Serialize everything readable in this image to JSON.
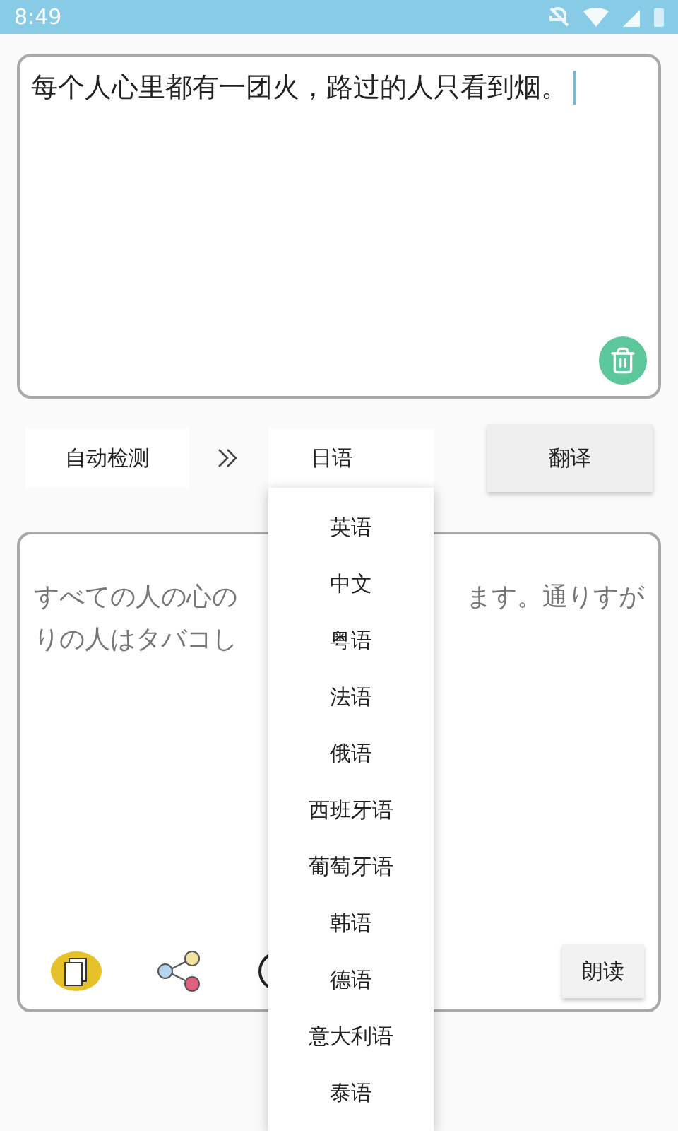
{
  "status_bar": {
    "time": "8:49"
  },
  "source": {
    "value": "每个人心里都有一团火，路过的人只看到烟。",
    "focused": true
  },
  "language_bar": {
    "from": "自动检测",
    "to": "日语",
    "translate_button": "翻译"
  },
  "result": {
    "lines": [
      {
        "left": "すべての人の心の",
        "right": "ます。通りすが"
      },
      {
        "left": "りの人はタバコし"
      }
    ],
    "read_button": "朗读"
  },
  "language_menu": {
    "expanded": true,
    "items": [
      {
        "label": "英语"
      },
      {
        "label": "中文"
      },
      {
        "label": "粤语"
      },
      {
        "label": "法语"
      },
      {
        "label": "俄语"
      },
      {
        "label": "西班牙语"
      },
      {
        "label": "葡萄牙语"
      },
      {
        "label": "韩语"
      },
      {
        "label": "德语"
      },
      {
        "label": "意大利语"
      },
      {
        "label": "泰语"
      }
    ]
  }
}
